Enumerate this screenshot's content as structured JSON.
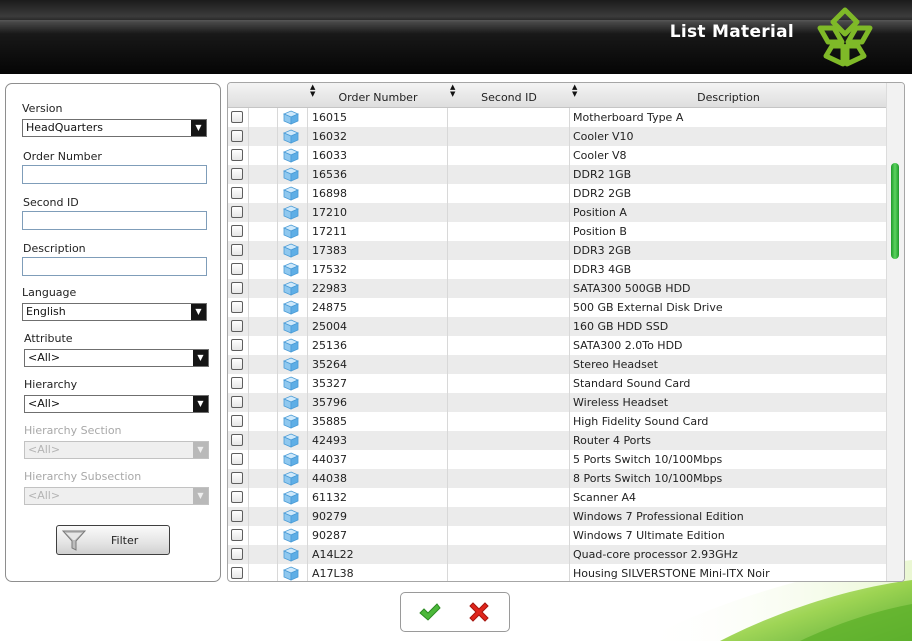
{
  "header": {
    "title": "List Material"
  },
  "filters": {
    "version": {
      "label": "Version",
      "value": "HeadQuarters"
    },
    "order_number": {
      "label": "Order Number",
      "value": ""
    },
    "second_id": {
      "label": "Second ID",
      "value": ""
    },
    "description": {
      "label": "Description",
      "value": ""
    },
    "language": {
      "label": "Language",
      "value": "English"
    },
    "attribute": {
      "label": "Attribute",
      "value": "<All>"
    },
    "hierarchy": {
      "label": "Hierarchy",
      "value": "<All>"
    },
    "hierarchy_section": {
      "label": "Hierarchy Section",
      "value": "<All>"
    },
    "hierarchy_subsection": {
      "label": "Hierarchy Subsection",
      "value": "<All>"
    },
    "filter_button_label": "Filter"
  },
  "grid": {
    "columns": {
      "order_number": "Order Number",
      "second_id": "Second ID",
      "description": "Description"
    },
    "rows": [
      {
        "order": "16015",
        "second": "",
        "desc": "Motherboard Type A"
      },
      {
        "order": "16032",
        "second": "",
        "desc": "Cooler V10"
      },
      {
        "order": "16033",
        "second": "",
        "desc": "Cooler V8"
      },
      {
        "order": "16536",
        "second": "",
        "desc": "DDR2 1GB"
      },
      {
        "order": "16898",
        "second": "",
        "desc": "DDR2 2GB"
      },
      {
        "order": "17210",
        "second": "",
        "desc": "Position A"
      },
      {
        "order": "17211",
        "second": "",
        "desc": "Position B"
      },
      {
        "order": "17383",
        "second": "",
        "desc": "DDR3 2GB"
      },
      {
        "order": "17532",
        "second": "",
        "desc": "DDR3 4GB"
      },
      {
        "order": "22983",
        "second": "",
        "desc": "SATA300 500GB HDD"
      },
      {
        "order": "24875",
        "second": "",
        "desc": "500 GB External Disk Drive"
      },
      {
        "order": "25004",
        "second": "",
        "desc": "160 GB HDD SSD"
      },
      {
        "order": "25136",
        "second": "",
        "desc": "SATA300 2.0To HDD"
      },
      {
        "order": "35264",
        "second": "",
        "desc": "Stereo Headset"
      },
      {
        "order": "35327",
        "second": "",
        "desc": "Standard Sound Card"
      },
      {
        "order": "35796",
        "second": "",
        "desc": "Wireless Headset"
      },
      {
        "order": "35885",
        "second": "",
        "desc": "High Fidelity Sound Card"
      },
      {
        "order": "42493",
        "second": "",
        "desc": "Router 4 Ports"
      },
      {
        "order": "44037",
        "second": "",
        "desc": "5 Ports Switch 10/100Mbps"
      },
      {
        "order": "44038",
        "second": "",
        "desc": "8 Ports Switch 10/100Mbps"
      },
      {
        "order": "61132",
        "second": "",
        "desc": "Scanner A4"
      },
      {
        "order": "90279",
        "second": "",
        "desc": "Windows 7 Professional Edition"
      },
      {
        "order": "90287",
        "second": "",
        "desc": "Windows 7 Ultimate Edition"
      },
      {
        "order": "A14L22",
        "second": "",
        "desc": "Quad-core processor 2.93GHz"
      },
      {
        "order": "A17L38",
        "second": "",
        "desc": "Housing SILVERSTONE Mini-ITX Noir"
      }
    ]
  },
  "icons": {
    "logo": "leaf-logo-icon",
    "filter": "funnel-icon",
    "row": "cube-icon",
    "ok": "checkmark-icon",
    "cancel": "cross-icon"
  },
  "colors": {
    "accent_green": "#3fa535",
    "scroll_green": "#2fb83a",
    "cancel_red": "#e0261c",
    "header_dark": "#111111"
  }
}
